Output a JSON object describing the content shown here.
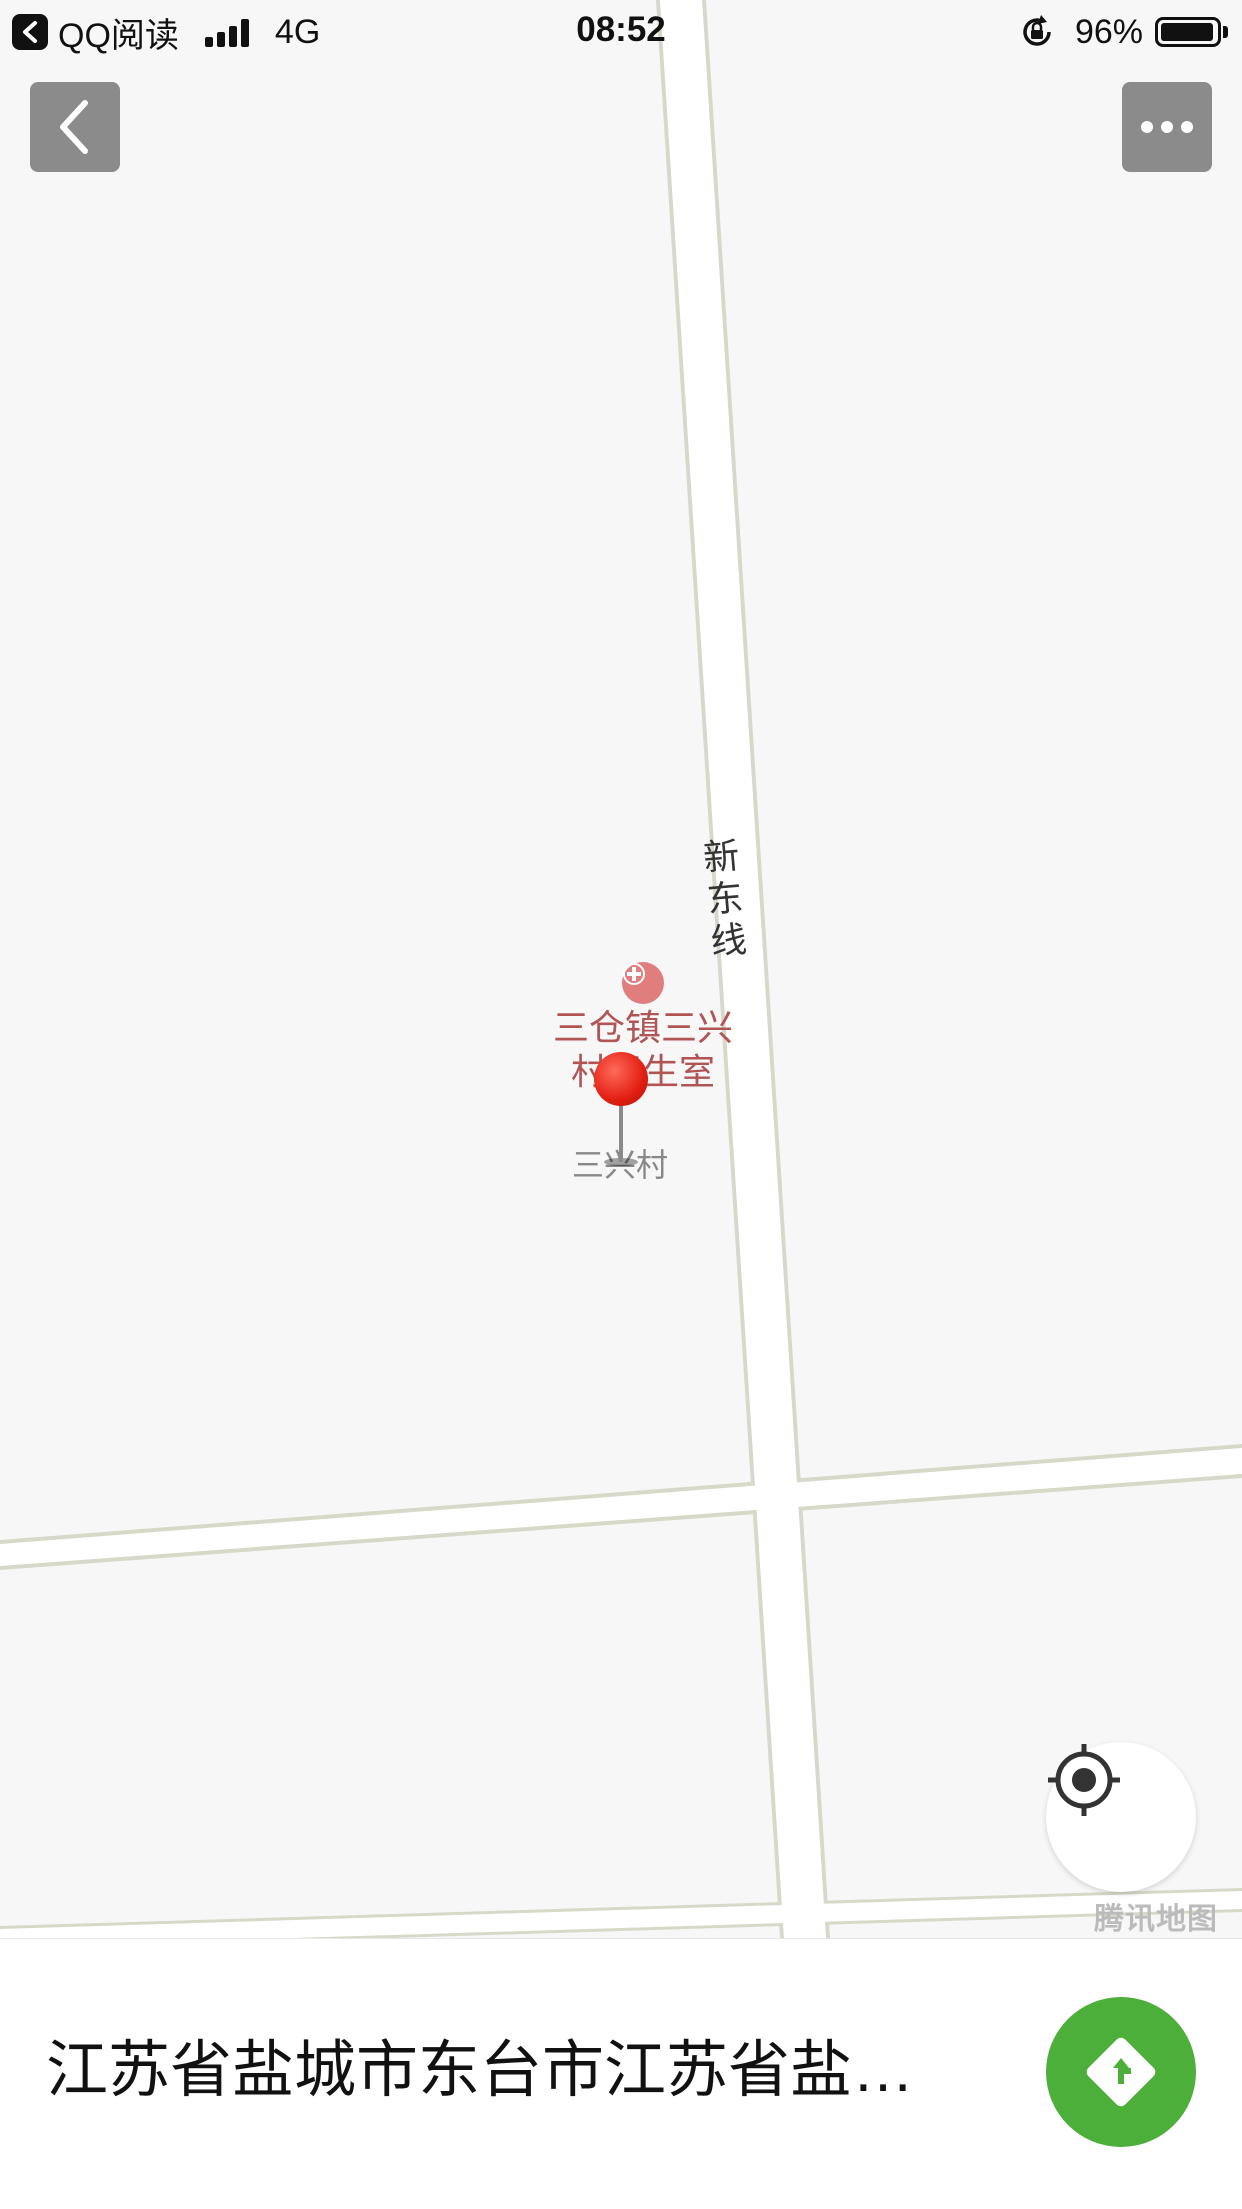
{
  "status_bar": {
    "app_name": "QQ阅读",
    "network": "4G",
    "time": "08:52",
    "battery": "96%",
    "battery_level": 0.96
  },
  "map": {
    "road_label": "新东线",
    "poi_label": "三仓镇三兴村卫生室",
    "village_label": "三兴村",
    "brand": "腾讯地图",
    "colors": {
      "land": "#f7f7f7",
      "road": "#ffffff",
      "road_edge": "#d8d8c8",
      "poi": "#b05454",
      "pin": "#e21e12"
    }
  },
  "toolbar": {
    "back_icon": "chevron-left-icon",
    "more_icon": "more-dots-icon",
    "locate_icon": "locate-target-icon"
  },
  "bottom_panel": {
    "address": "江苏省盐城市东台市江苏省盐…",
    "nav_icon": "navigate-arrow-icon",
    "nav_color": "#4caf39"
  }
}
